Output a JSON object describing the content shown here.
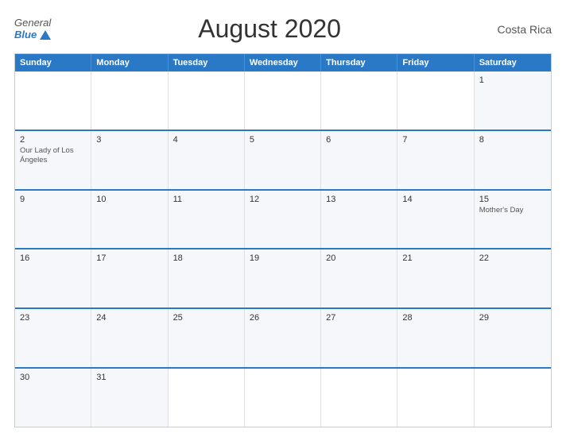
{
  "header": {
    "logo_general": "General",
    "logo_blue": "Blue",
    "title": "August 2020",
    "country": "Costa Rica"
  },
  "days_of_week": [
    "Sunday",
    "Monday",
    "Tuesday",
    "Wednesday",
    "Thursday",
    "Friday",
    "Saturday"
  ],
  "weeks": [
    [
      {
        "day": "",
        "event": ""
      },
      {
        "day": "",
        "event": ""
      },
      {
        "day": "",
        "event": ""
      },
      {
        "day": "",
        "event": ""
      },
      {
        "day": "",
        "event": ""
      },
      {
        "day": "",
        "event": ""
      },
      {
        "day": "1",
        "event": ""
      }
    ],
    [
      {
        "day": "2",
        "event": "Our Lady of Los Ángeles"
      },
      {
        "day": "3",
        "event": ""
      },
      {
        "day": "4",
        "event": ""
      },
      {
        "day": "5",
        "event": ""
      },
      {
        "day": "6",
        "event": ""
      },
      {
        "day": "7",
        "event": ""
      },
      {
        "day": "8",
        "event": ""
      }
    ],
    [
      {
        "day": "9",
        "event": ""
      },
      {
        "day": "10",
        "event": ""
      },
      {
        "day": "11",
        "event": ""
      },
      {
        "day": "12",
        "event": ""
      },
      {
        "day": "13",
        "event": ""
      },
      {
        "day": "14",
        "event": ""
      },
      {
        "day": "15",
        "event": "Mother's Day"
      }
    ],
    [
      {
        "day": "16",
        "event": ""
      },
      {
        "day": "17",
        "event": ""
      },
      {
        "day": "18",
        "event": ""
      },
      {
        "day": "19",
        "event": ""
      },
      {
        "day": "20",
        "event": ""
      },
      {
        "day": "21",
        "event": ""
      },
      {
        "day": "22",
        "event": ""
      }
    ],
    [
      {
        "day": "23",
        "event": ""
      },
      {
        "day": "24",
        "event": ""
      },
      {
        "day": "25",
        "event": ""
      },
      {
        "day": "26",
        "event": ""
      },
      {
        "day": "27",
        "event": ""
      },
      {
        "day": "28",
        "event": ""
      },
      {
        "day": "29",
        "event": ""
      }
    ],
    [
      {
        "day": "30",
        "event": ""
      },
      {
        "day": "31",
        "event": ""
      },
      {
        "day": "",
        "event": ""
      },
      {
        "day": "",
        "event": ""
      },
      {
        "day": "",
        "event": ""
      },
      {
        "day": "",
        "event": ""
      },
      {
        "day": "",
        "event": ""
      }
    ]
  ]
}
